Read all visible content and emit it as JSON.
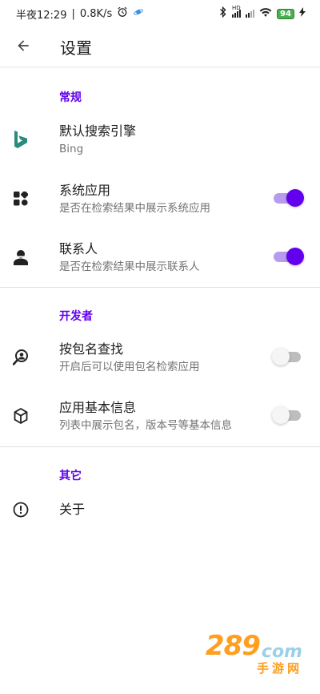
{
  "status_bar": {
    "time": "半夜12:29",
    "speed": "0.8K/s",
    "separator": "|",
    "battery": "94",
    "signal_tag": "HD"
  },
  "app_bar": {
    "title": "设置",
    "back_icon": "arrow-back-icon"
  },
  "sections": {
    "general": {
      "header": "常规",
      "items": [
        {
          "title": "默认搜索引擎",
          "subtitle": "Bing",
          "icon": "bing-icon"
        },
        {
          "title": "系统应用",
          "subtitle": "是否在检索结果中展示系统应用",
          "icon": "apps-icon",
          "toggle": "on"
        },
        {
          "title": "联系人",
          "subtitle": "是否在检索结果中展示联系人",
          "icon": "person-icon",
          "toggle": "on"
        }
      ]
    },
    "developer": {
      "header": "开发者",
      "items": [
        {
          "title": "按包名查找",
          "subtitle": "开启后可以使用包名检索应用",
          "icon": "search-person-icon",
          "toggle": "off"
        },
        {
          "title": "应用基本信息",
          "subtitle": "列表中展示包名，版本号等基本信息",
          "icon": "cube-icon",
          "toggle": "off"
        }
      ]
    },
    "other": {
      "header": "其它",
      "items": [
        {
          "title": "关于",
          "icon": "info-icon"
        }
      ]
    }
  },
  "watermark": {
    "number": "289",
    "domain": "com",
    "text": "手游网"
  },
  "colors": {
    "accent": "#6200ee",
    "accent_track": "#b79bef",
    "bing": "#2a8b7f",
    "subtitle": "#737373"
  }
}
